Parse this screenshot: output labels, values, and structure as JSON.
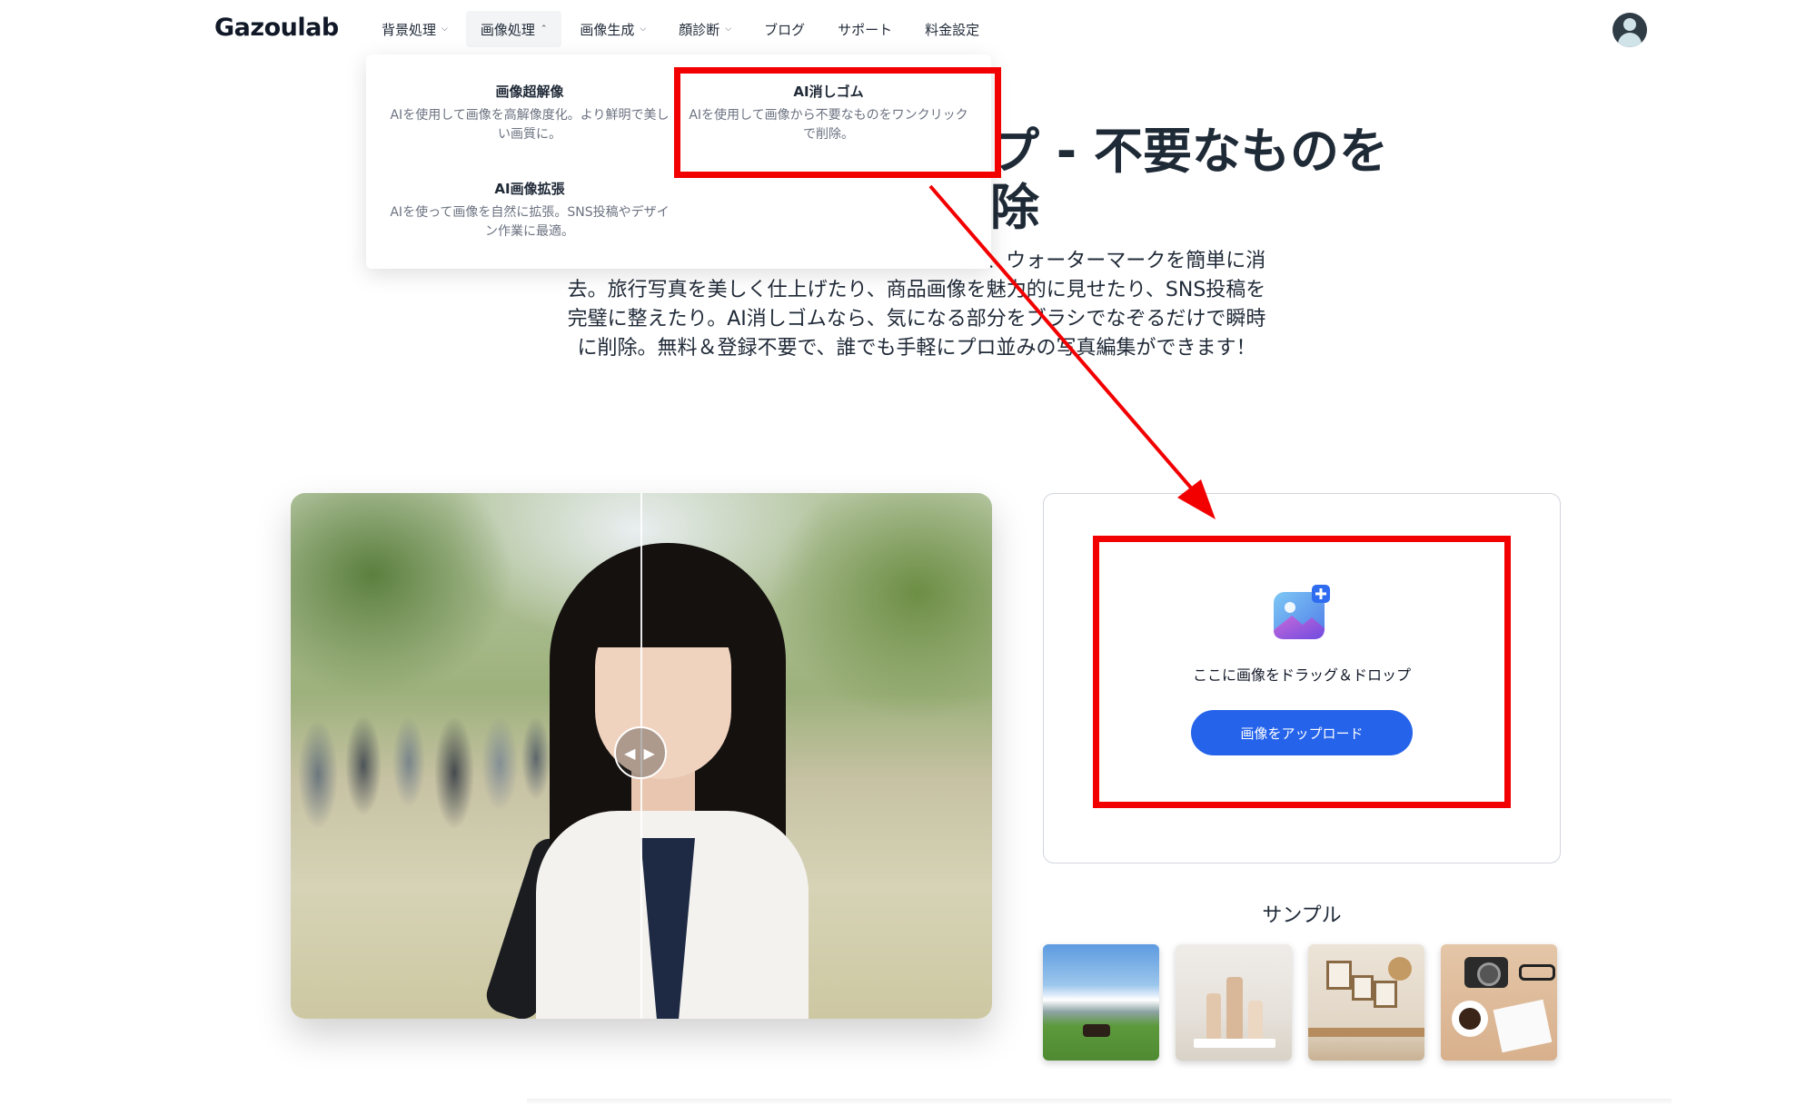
{
  "header": {
    "logo": "Gazoulab",
    "nav": [
      {
        "label": "背景処理",
        "chevron": "down"
      },
      {
        "label": "画像処理",
        "chevron": "up"
      },
      {
        "label": "画像生成",
        "chevron": "down"
      },
      {
        "label": "顔診断",
        "chevron": "down"
      },
      {
        "label": "ブログ"
      },
      {
        "label": "サポート"
      },
      {
        "label": "料金設定"
      }
    ],
    "avatar_icon": "user-avatar-icon"
  },
  "dropdown": {
    "items": [
      {
        "title": "画像超解像",
        "desc": "AIを使用して画像を高解像度化。より鮮明で美しい画質に。"
      },
      {
        "title": "AI消しゴム",
        "desc": "AIを使用して画像から不要なものをワンクリックで削除。"
      },
      {
        "title": "AI画像拡張",
        "desc": "AIを使って画像を自然に拡張。SNS投稿やデザイン作業に最適。"
      }
    ]
  },
  "hero": {
    "title_line1": "プ - 不要なものを",
    "title_line2": "除",
    "description": "写真から不要なオブジェクト、人物、テキスト、ウォーターマークを簡単に消去。旅行写真を美しく仕上げたり、商品画像を魅力的に見せたり、SNS投稿を完璧に整えたり。AI消しゴムなら、気になる部分をブラシでなぞるだけで瞬時に削除。無料＆登録不要で、誰でも手軽にプロ並みの写真編集ができます！"
  },
  "compare": {
    "handle_icon": "◀ ▶"
  },
  "upload": {
    "drop_text": "ここに画像をドラッグ＆ドロップ",
    "button_label": "画像をアップロード"
  },
  "samples": {
    "title": "サンプル"
  },
  "colors": {
    "accent": "#2563eb",
    "annotation": "#f20000",
    "text": "#1f2a37"
  }
}
